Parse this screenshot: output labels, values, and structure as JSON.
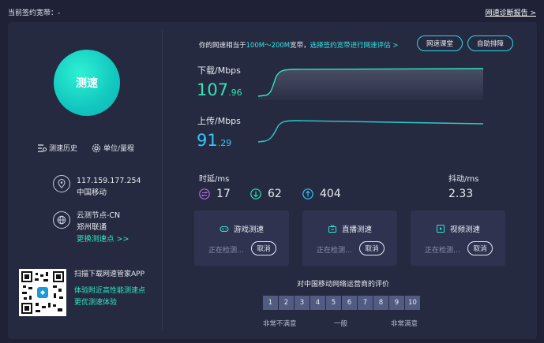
{
  "header": {
    "bandwidth_label": "当前签约宽带：-",
    "report_link": "网速诊断报告 >"
  },
  "left": {
    "start_button": "测速",
    "history": "测速历史",
    "unit": "单位/量程",
    "ip": "117.159.177.254",
    "isp": "中国移动",
    "node": "云测节点-CN",
    "node_city": "郑州联通",
    "change_node": "更换测速点 >>",
    "app_title": "扫描下载网速管家APP",
    "app_line1": "体验附近高性能测速点",
    "app_line2": "更优测速体验"
  },
  "summary": {
    "prefix": "你的网速相当于",
    "range": "100M～200M",
    "suffix": "宽带，",
    "eval_link": "选择签约宽带进行网速评估 >"
  },
  "buttons": {
    "classroom": "网速课堂",
    "selfcheck": "自助排障"
  },
  "download": {
    "label": "下载/Mbps",
    "int": "107",
    "dec": ".96"
  },
  "upload": {
    "label": "上传/Mbps",
    "int": "91",
    "dec": ".29"
  },
  "latency": {
    "label": "时延/ms",
    "avg": "17",
    "min": "62",
    "max": "404"
  },
  "jitter": {
    "label": "抖动/ms",
    "value": "2.33"
  },
  "tests": [
    {
      "title": "游戏测速",
      "status": "正在检测...",
      "cancel": "取消"
    },
    {
      "title": "直播测速",
      "status": "正在检测...",
      "cancel": "取消"
    },
    {
      "title": "视频测速",
      "status": "正在检测...",
      "cancel": "取消"
    }
  ],
  "rating": {
    "title": "对中国移动网络运营商的评价",
    "scores": [
      "1",
      "2",
      "3",
      "4",
      "5",
      "6",
      "7",
      "8",
      "9",
      "10"
    ],
    "low": "非常不满意",
    "mid": "一般",
    "high": "非常满意"
  },
  "colors": {
    "accent_green": "#2ee6b8",
    "accent_cyan": "#2ec8ff",
    "link_green": "#2ee6c2",
    "panel_bg": "#262a40"
  }
}
